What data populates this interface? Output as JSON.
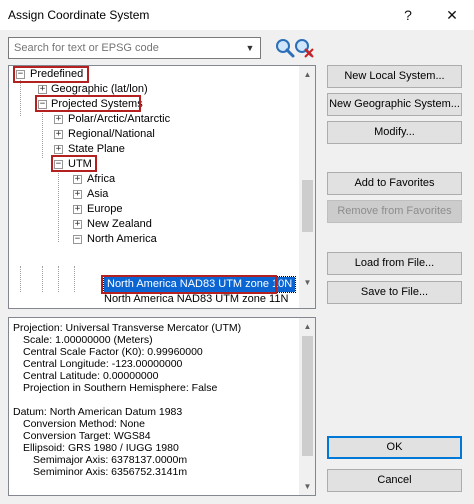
{
  "window": {
    "title": "Assign Coordinate System",
    "help_glyph": "?",
    "close_glyph": "✕"
  },
  "search": {
    "placeholder": "Search for text or EPSG code",
    "value": ""
  },
  "tree": {
    "expand_minus": "−",
    "expand_plus": "+",
    "nodes": [
      {
        "label": "Predefined"
      },
      {
        "label": "Geographic (lat/lon)"
      },
      {
        "label": "Projected Systems"
      },
      {
        "label": "Polar/Arctic/Antarctic"
      },
      {
        "label": "Regional/National"
      },
      {
        "label": "State Plane"
      },
      {
        "label": "UTM"
      },
      {
        "label": "Africa"
      },
      {
        "label": "Asia"
      },
      {
        "label": "Europe"
      },
      {
        "label": "New Zealand"
      },
      {
        "label": "North America"
      },
      {
        "label": "North America NAD83 UTM zone 10N"
      },
      {
        "label": "North America NAD83 UTM zone 11N"
      }
    ]
  },
  "buttons": {
    "new_local": "New Local System...",
    "new_geographic": "New Geographic System...",
    "modify": "Modify...",
    "add_favorites": "Add to Favorites",
    "remove_favorites": "Remove from Favorites",
    "load_file": "Load from File...",
    "save_file": "Save to File...",
    "ok": "OK",
    "cancel": "Cancel"
  },
  "info_lines": [
    "Projection: Universal Transverse Mercator (UTM)",
    "  Scale: 1.00000000 (Meters)",
    "  Central Scale Factor (K0): 0.99960000",
    "  Central Longitude: -123.00000000",
    "  Central Latitude: 0.00000000",
    "  Projection in Southern Hemisphere: False",
    "",
    "Datum: North American Datum 1983",
    "  Conversion Method: None",
    "  Conversion Target: WGS84",
    "  Ellipsoid: GRS 1980 / IUGG 1980",
    "    Semimajor Axis: 6378137.0000m",
    "    Semiminor Axis: 6356752.3141m"
  ],
  "scroll_arrows": {
    "up": "▲",
    "down": "▼",
    "left": "◀",
    "right": "▶"
  },
  "colors": {
    "highlight_border": "#b42020",
    "selection": "#0a64d2",
    "primary_border": "#0078d7"
  }
}
